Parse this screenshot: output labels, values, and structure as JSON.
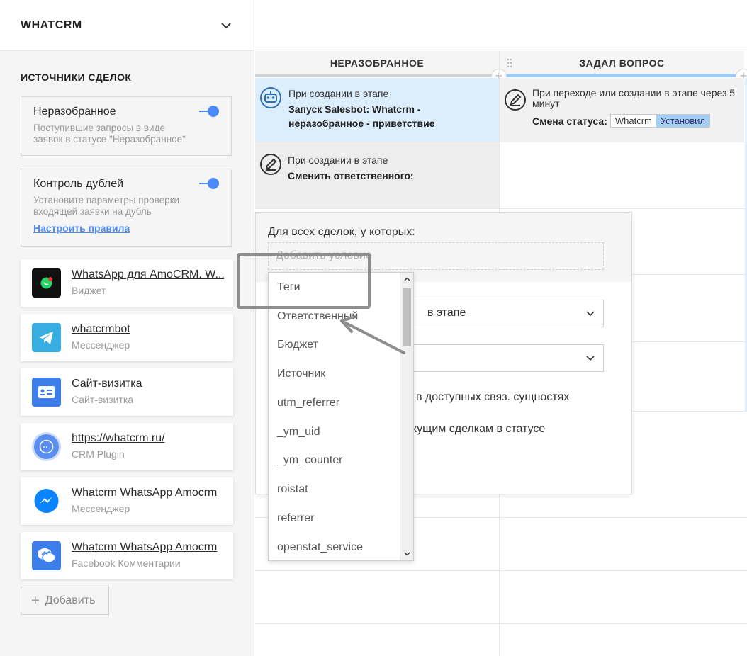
{
  "sidebar": {
    "title": "WHATCRM",
    "section_title": "ИСТОЧНИКИ СДЕЛОК",
    "box_unsorted": {
      "title": "Неразобранное",
      "desc": "Поступившие запросы в виде заявок в статусе \"Неразобранное\""
    },
    "box_duplicates": {
      "title": "Контроль дублей",
      "desc": "Установите параметры проверки входящей заявки на дубль",
      "link": "Настроить правила"
    },
    "sources": [
      {
        "name": "WhatsApp для AmoCRM. W...",
        "type": "Виджет",
        "icon": "whatsapp-icon"
      },
      {
        "name": "whatcrmbot",
        "type": "Мессенджер",
        "icon": "telegram-icon"
      },
      {
        "name": "Сайт-визитка",
        "type": "Сайт-визитка",
        "icon": "id-card-icon"
      },
      {
        "name": "https://whatcrm.ru/",
        "type": "CRM Plugin",
        "icon": "chat-bubbles-icon"
      },
      {
        "name": "Whatcrm WhatsApp Amocrm",
        "type": "Мессенджер",
        "icon": "messenger-icon"
      },
      {
        "name": "Whatcrm WhatsApp Amocrm",
        "type": "Facebook Комментарии",
        "icon": "comments-icon"
      }
    ],
    "add_button": "Добавить"
  },
  "board": {
    "columns": [
      {
        "title": "НЕРАЗОБРАННОЕ"
      },
      {
        "title": "ЗАДАЛ ВОПРОС"
      }
    ],
    "cells": {
      "col1_row1": {
        "line1": "При создании в этапе",
        "line2": "Запуск Salesbot: Whatcrm - неразобранное - приветствие"
      },
      "col1_row2": {
        "line1": "При создании в этапе",
        "line2": "Сменить ответственного:"
      },
      "col2_row1": {
        "line1": "При переходе или создании в этапе через 5 минут",
        "status_label": "Смена статуса:",
        "pill_a": "Whatcrm",
        "pill_b": "Установил"
      }
    },
    "colors": {
      "accent": "#4c8bf5",
      "col1_bar": "#d1d1d1",
      "col2_bar": "#9fcaf3",
      "highlight_cell": "#dcedfb"
    }
  },
  "popup": {
    "label": "Для всех сделок, у которых:",
    "condition_placeholder": "Добавить условие",
    "select1_value": "в этапе",
    "checkbox1": "в доступных связ. сущностях",
    "checkbox2": "кущим сделкам в статусе"
  },
  "dropdown": {
    "items": [
      "Теги",
      "Ответственный",
      "Бюджет",
      "Источник",
      "utm_referrer",
      "_ym_uid",
      "_ym_counter",
      "roistat",
      "referrer",
      "openstat_service"
    ]
  }
}
